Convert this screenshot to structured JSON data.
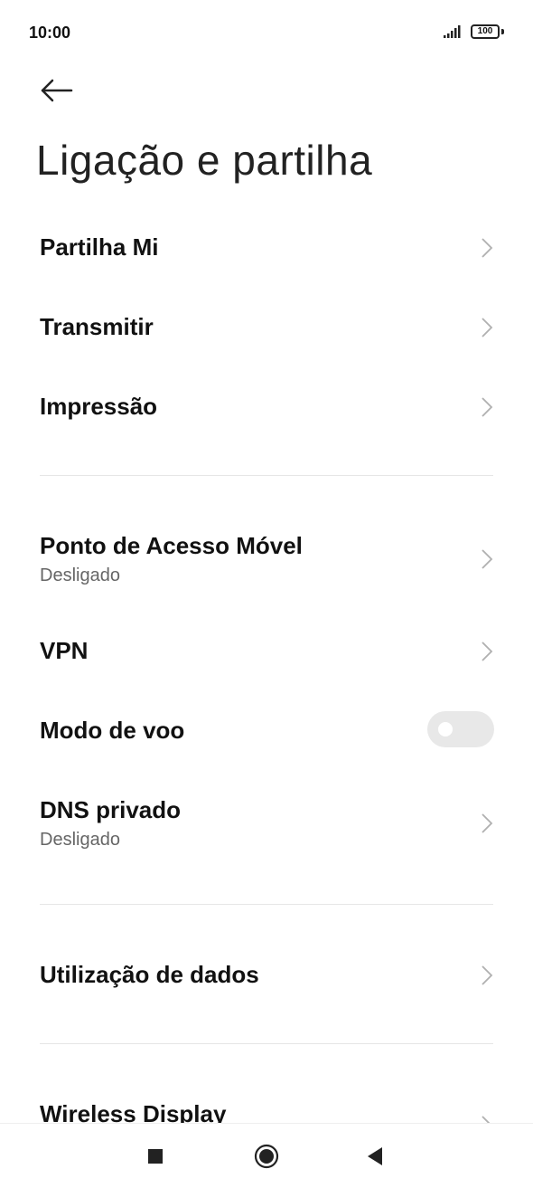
{
  "status_bar": {
    "time": "10:00",
    "battery": "100"
  },
  "page": {
    "title": "Ligação e partilha"
  },
  "settings": {
    "partilha_mi": {
      "label": "Partilha Mi"
    },
    "transmitir": {
      "label": "Transmitir"
    },
    "impressao": {
      "label": "Impressão"
    },
    "hotspot": {
      "label": "Ponto de Acesso Móvel",
      "status": "Desligado"
    },
    "vpn": {
      "label": "VPN"
    },
    "airplane": {
      "label": "Modo de voo",
      "enabled": false
    },
    "dns": {
      "label": "DNS privado",
      "status": "Desligado"
    },
    "data_usage": {
      "label": "Utilização de dados"
    },
    "wireless_display": {
      "label": "Wireless Display"
    }
  },
  "icons": {
    "back": "arrow-left-icon",
    "chevron": "chevron-right-icon",
    "recents": "square-icon",
    "home": "circle-icon",
    "back_nav": "triangle-left-icon"
  },
  "colors": {
    "background": "#ffffff",
    "text": "#111111",
    "subtext": "#666666",
    "divider": "#e6e6e6",
    "toggle_off": "#e8e8e8"
  }
}
